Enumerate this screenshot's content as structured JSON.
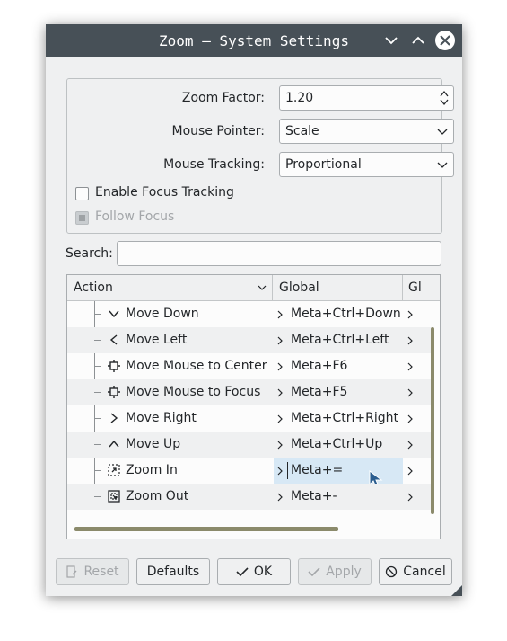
{
  "window": {
    "title": "Zoom — System Settings",
    "controls": {
      "minimize_icon": "chevron-down-icon",
      "maximize_icon": "chevron-up-icon",
      "close_icon": "close-icon"
    }
  },
  "settings": {
    "zoom_factor": {
      "label": "Zoom Factor:",
      "value": "1.20"
    },
    "mouse_pointer": {
      "label": "Mouse Pointer:",
      "value": "Scale"
    },
    "mouse_tracking": {
      "label": "Mouse Tracking:",
      "value": "Proportional"
    },
    "enable_focus_tracking": {
      "label": "Enable Focus Tracking",
      "checked": false
    },
    "follow_focus": {
      "label": "Follow Focus",
      "checked": false,
      "disabled": true
    }
  },
  "search": {
    "label": "Search:",
    "value": "",
    "placeholder": ""
  },
  "shortcuts": {
    "columns": [
      "Action",
      "Global",
      "Gl"
    ],
    "rows": [
      {
        "icon": "arrow-down-icon",
        "action": "Move Down",
        "global": "Meta+Ctrl+Down"
      },
      {
        "icon": "arrow-left-icon",
        "action": "Move Left",
        "global": "Meta+Ctrl+Left"
      },
      {
        "icon": "crosshair-icon",
        "action": "Move Mouse to Center",
        "global": "Meta+F6"
      },
      {
        "icon": "crosshair-icon",
        "action": "Move Mouse to Focus",
        "global": "Meta+F5"
      },
      {
        "icon": "arrow-right-icon",
        "action": "Move Right",
        "global": "Meta+Ctrl+Right"
      },
      {
        "icon": "arrow-up-icon",
        "action": "Move Up",
        "global": "Meta+Ctrl+Up"
      },
      {
        "icon": "zoom-in-icon",
        "action": "Zoom In",
        "global": "Meta+=",
        "selected": true
      },
      {
        "icon": "zoom-out-icon",
        "action": "Zoom Out",
        "global": "Meta+-"
      }
    ]
  },
  "buttons": {
    "reset": "Reset",
    "defaults": "Defaults",
    "ok": "OK",
    "apply": "Apply",
    "cancel": "Cancel"
  },
  "colors": {
    "titlebar": "#475057",
    "window_bg": "#eff0f1",
    "selection": "#d7e8f5",
    "scrollbar": "#8b8a6b",
    "pointer": "#2a5d8f"
  }
}
